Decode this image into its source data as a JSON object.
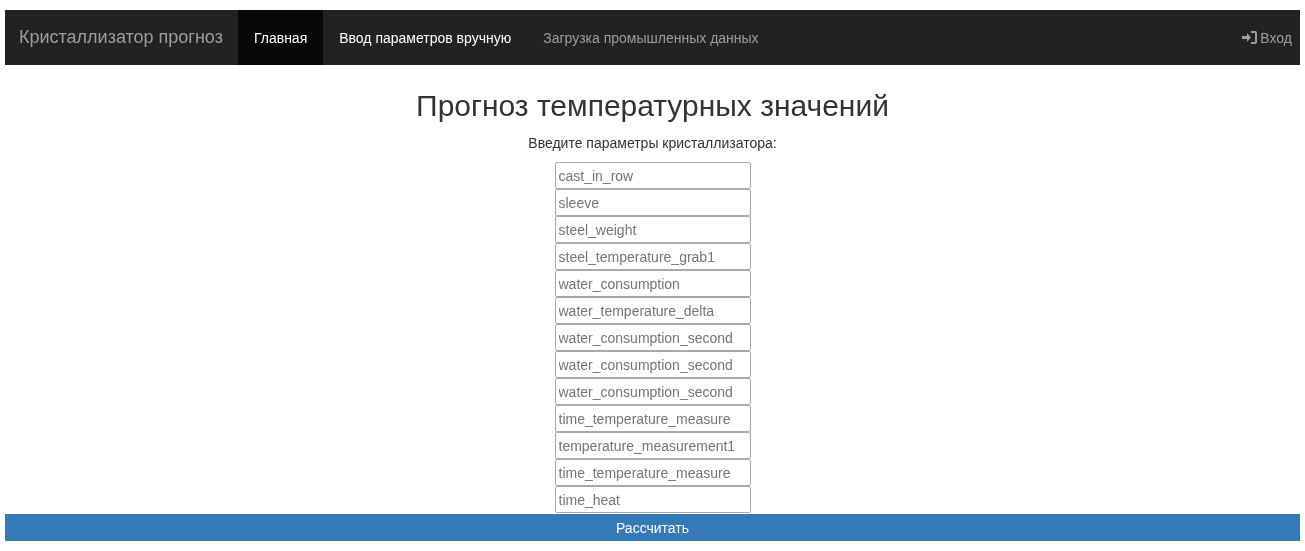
{
  "navbar": {
    "brand": "Кристаллизатор прогноз",
    "items": [
      {
        "label": "Главная",
        "selected": true,
        "highlight": false
      },
      {
        "label": "Ввод параметров вручную",
        "selected": false,
        "highlight": true
      },
      {
        "label": "Загрузка промышленных данных",
        "selected": false,
        "highlight": false
      }
    ],
    "login": "Вход"
  },
  "title": "Прогноз температурных значений",
  "subtitle": "Введите параметры кристаллизатора:",
  "fields": [
    {
      "placeholder": "cast_in_row"
    },
    {
      "placeholder": "sleeve"
    },
    {
      "placeholder": "steel_weight"
    },
    {
      "placeholder": "steel_temperature_grab1"
    },
    {
      "placeholder": "water_consumption"
    },
    {
      "placeholder": "water_temperature_delta"
    },
    {
      "placeholder": "water_consumption_second"
    },
    {
      "placeholder": "water_consumption_second"
    },
    {
      "placeholder": "water_consumption_second"
    },
    {
      "placeholder": "time_temperature_measure"
    },
    {
      "placeholder": "temperature_measurement1"
    },
    {
      "placeholder": "time_temperature_measure"
    },
    {
      "placeholder": "time_heat"
    }
  ],
  "submit": "Рассчитать"
}
